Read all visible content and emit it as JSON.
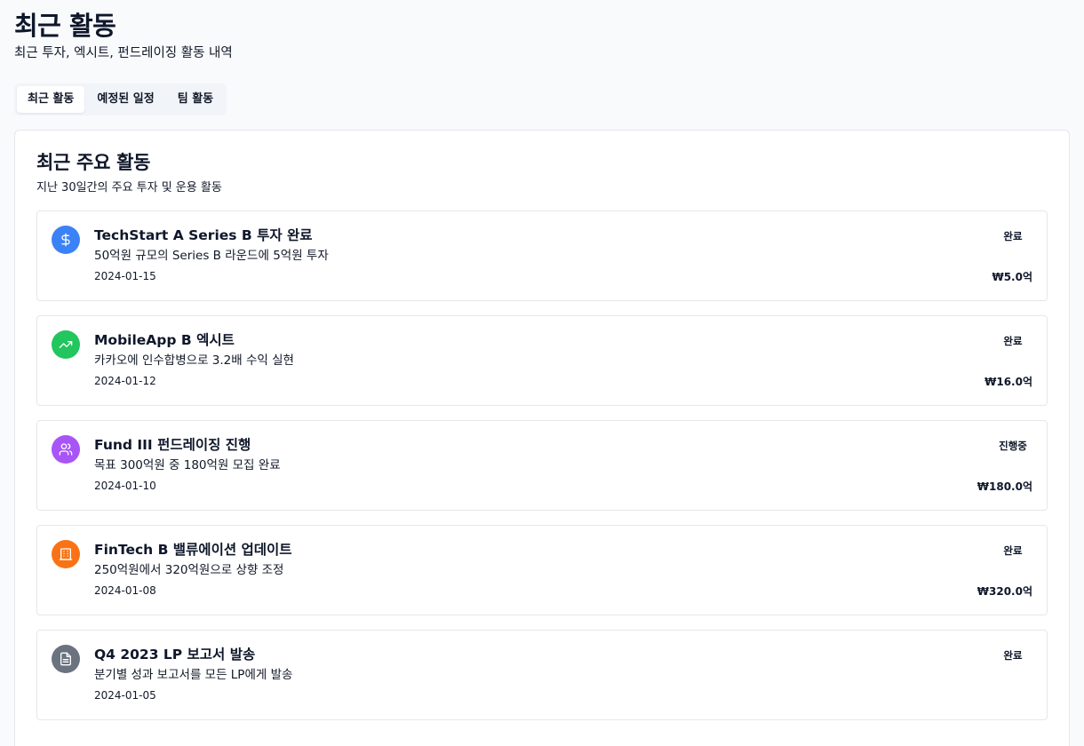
{
  "header": {
    "title": "최근 활동",
    "subtitle": "최근 투자, 엑시트, 펀드레이징 활동 내역"
  },
  "tabs": [
    {
      "label": "최근 활동",
      "active": true
    },
    {
      "label": "예정된 일정",
      "active": false
    },
    {
      "label": "팀 활동",
      "active": false
    }
  ],
  "card": {
    "title": "최근 주요 활동",
    "description": "지난 30일간의 주요 투자 및 운용 활동"
  },
  "colors": {
    "blue": "#3b82f6",
    "green": "#22c55e",
    "purple": "#a855f7",
    "orange": "#f97316",
    "gray": "#6b7280"
  },
  "activities": [
    {
      "icon": "dollar-icon",
      "color": "#3b82f6",
      "title": "TechStart A Series B 투자 완료",
      "description": "50억원 규모의 Series B 라운드에 5억원 투자",
      "date": "2024-01-15",
      "status": "완료",
      "amount": "₩5.0억"
    },
    {
      "icon": "trending-up-icon",
      "color": "#22c55e",
      "title": "MobileApp B 엑시트",
      "description": "카카오에 인수합병으로 3.2배 수익 실현",
      "date": "2024-01-12",
      "status": "완료",
      "amount": "₩16.0억"
    },
    {
      "icon": "users-icon",
      "color": "#a855f7",
      "title": "Fund III 펀드레이징 진행",
      "description": "목표 300억원 중 180억원 모집 완료",
      "date": "2024-01-10",
      "status": "진행중",
      "amount": "₩180.0억"
    },
    {
      "icon": "building-icon",
      "color": "#f97316",
      "title": "FinTech B 밸류에이션 업데이트",
      "description": "250억원에서 320억원으로 상향 조정",
      "date": "2024-01-08",
      "status": "완료",
      "amount": "₩320.0억"
    },
    {
      "icon": "document-icon",
      "color": "#6b7280",
      "title": "Q4 2023 LP 보고서 발송",
      "description": "분기별 성과 보고서를 모든 LP에게 발송",
      "date": "2024-01-05",
      "status": "완료",
      "amount": ""
    }
  ]
}
